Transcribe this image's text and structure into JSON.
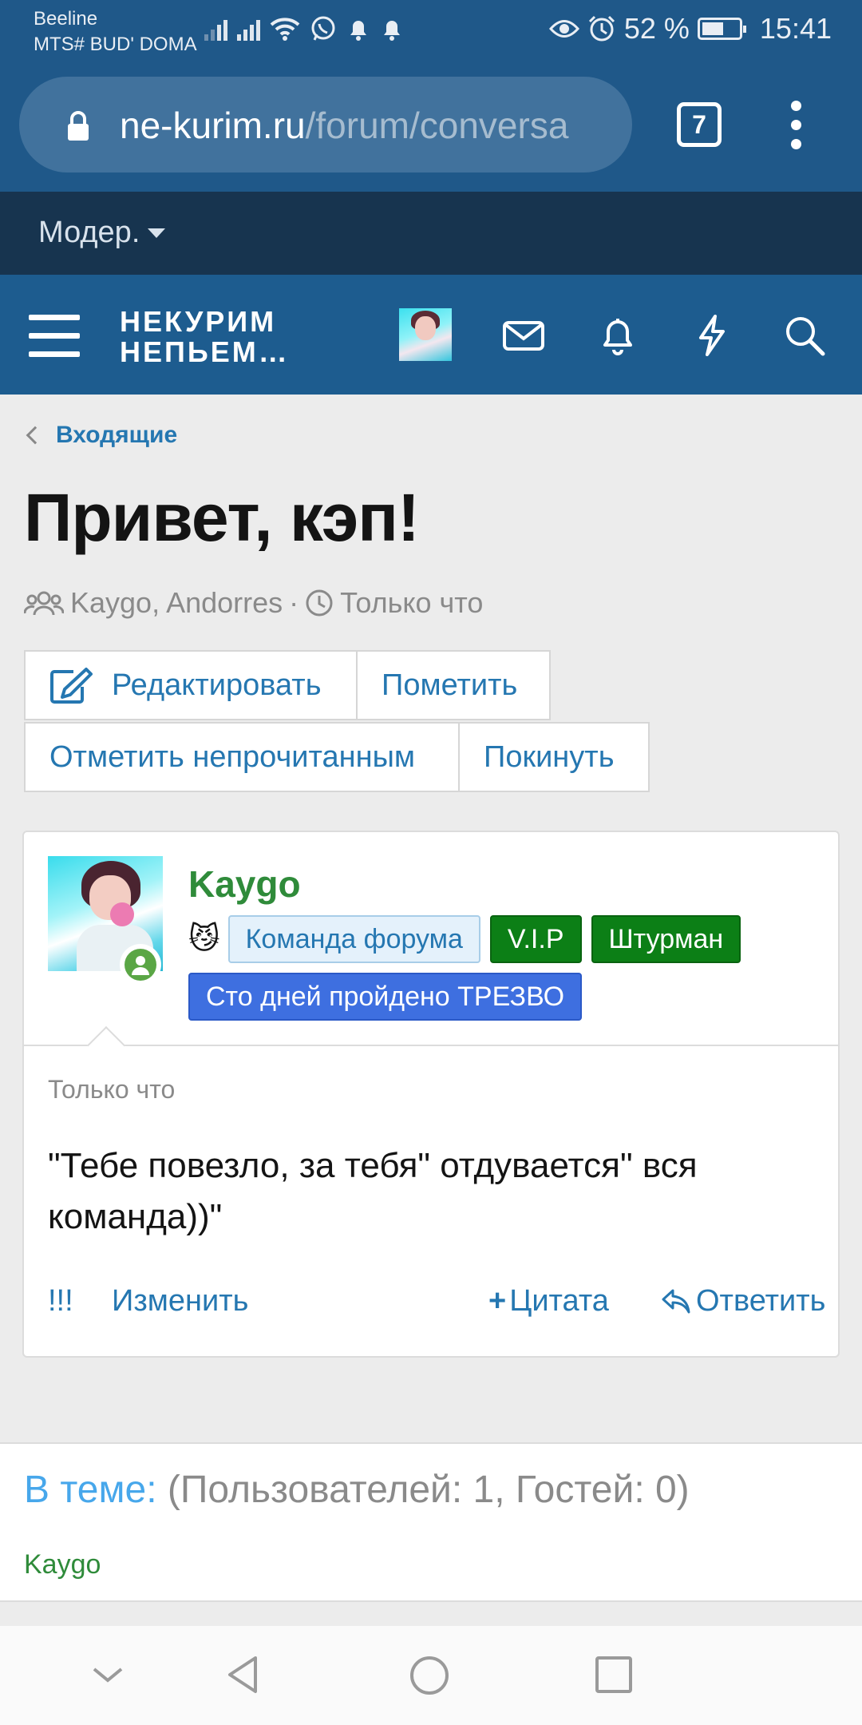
{
  "status_bar": {
    "carrier_1": "Beeline",
    "carrier_2": "MTS# BUD' DOMA",
    "battery": "52 %",
    "battery_level": 0.52,
    "time": "15:41",
    "icons": [
      "signal-icon",
      "signal-icon",
      "wifi-icon",
      "whatsapp-icon",
      "bell-icon",
      "bell-icon",
      "eye-icon",
      "alarm-icon",
      "battery-icon"
    ]
  },
  "browser": {
    "url_host": "ne-kurim.ru",
    "url_path": "/forum/conversa",
    "tab_count": "7",
    "menu_icon": "kebab-icon"
  },
  "mod_bar": {
    "label": "Модер."
  },
  "site_header": {
    "logo_line1": "НЕКУРИМ",
    "logo_line2": "НЕПЬЕМ…",
    "icons": [
      "menu-icon",
      "avatar",
      "mail-icon",
      "bell-icon",
      "lightning-icon",
      "search-icon"
    ]
  },
  "page": {
    "breadcrumb": "Входящие",
    "title": "Привет, кэп!",
    "participants": "Kaygo, Andorres",
    "separator": "·",
    "time": "Только что"
  },
  "buttons": {
    "edit": "Редактировать",
    "mark": "Пометить",
    "mark_unread": "Отметить непрочитанным",
    "leave": "Покинуть"
  },
  "message": {
    "author": "Kaygo",
    "emoji": "😼",
    "badges": {
      "team": "Команда форума",
      "vip": "V.I.P",
      "navigator": "Штурман",
      "sober": "Сто дней пройдено ТРЕЗВО"
    },
    "time": "Только что",
    "body": "\"Тебе повезло, за тебя\" отдувается\" вся команда))\"",
    "actions": {
      "report": "!!!",
      "edit": "Изменить",
      "quote_plus": "+",
      "quote": "Цитата",
      "reply": "Ответить"
    }
  },
  "in_thread": {
    "label": "В теме:",
    "counts": "(Пользователей: 1, Гостей: 0)",
    "user": "Kaygo"
  },
  "colors": {
    "header_blue": "#1d5c8f",
    "mod_bar": "#17344f",
    "link_blue": "#2577b1",
    "username_green": "#2f8b3a",
    "badge_green": "#0c7f16",
    "badge_royal": "#3e6fe0"
  }
}
